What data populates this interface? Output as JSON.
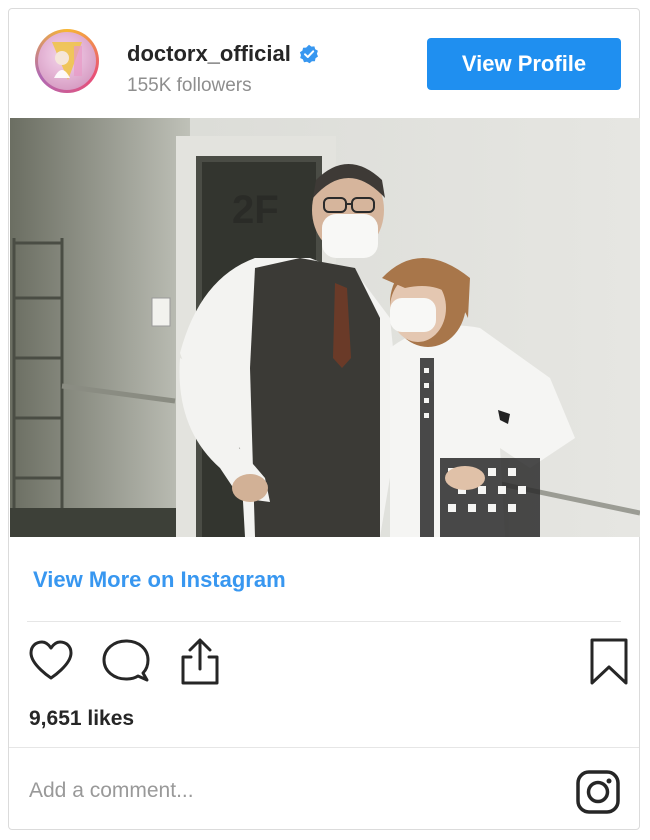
{
  "header": {
    "username": "doctorx_official",
    "followers": "155K followers",
    "view_profile_label": "View Profile"
  },
  "post": {
    "image_icon": "photo",
    "view_more_label": "View More on Instagram",
    "likes": "9,651 likes",
    "comment_placeholder": "Add a comment..."
  },
  "icons": {
    "verified": "verified-badge-icon",
    "like": "heart-icon",
    "comment": "comment-bubble-icon",
    "share": "share-icon",
    "save": "bookmark-icon",
    "instagram": "instagram-logo-icon"
  },
  "colors": {
    "accent": "#3897f0",
    "button": "#1f8ff0",
    "text": "#262626",
    "muted": "#8e8e8e"
  }
}
